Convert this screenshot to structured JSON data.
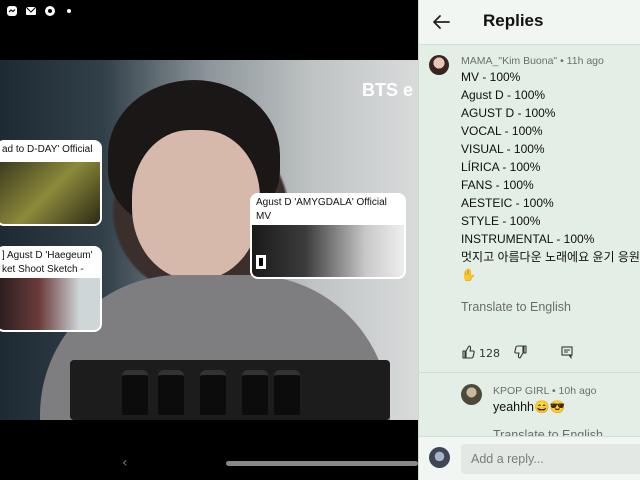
{
  "status_icons": [
    "messenger-icon",
    "mail-icon",
    "chrome-icon",
    "dot-icon"
  ],
  "video": {
    "watermark": "BTS e",
    "cards": [
      {
        "title": "ad to D-DAY' Official"
      },
      {
        "title": "Agust D 'AMYGDALA' Official",
        "title2": "MV",
        "badge": "BIGHIT MUSIC"
      },
      {
        "title": "] Agust D 'Haegeum'",
        "title2": "ket Shoot Sketch -"
      }
    ]
  },
  "panel": {
    "header_title": "Replies",
    "comment": {
      "author": "MAMA_\"Kim Buona\"",
      "time": "11h ago",
      "lines": [
        "MV - 100%",
        "Agust D - 100%",
        "AGUST D - 100%",
        "VOCAL - 100%",
        "VISUAL - 100%",
        "LÍRICA - 100%",
        "FANS - 100%",
        "AESTEIC - 100%",
        "STYLE - 100%",
        "INSTRUMENTAL - 100%",
        "멋지고 아름다운 노래에요 윤기 응원",
        "✋"
      ],
      "translate": "Translate to English",
      "likes": "128"
    },
    "reply": {
      "author": "KPOP GIRL",
      "time": "10h ago",
      "text": "yeahhh😄😎",
      "translate": "Translate to English"
    },
    "input_placeholder": "Add a reply..."
  },
  "colors": {
    "panel_bg": "#e3efe6",
    "accent": "#111111"
  }
}
